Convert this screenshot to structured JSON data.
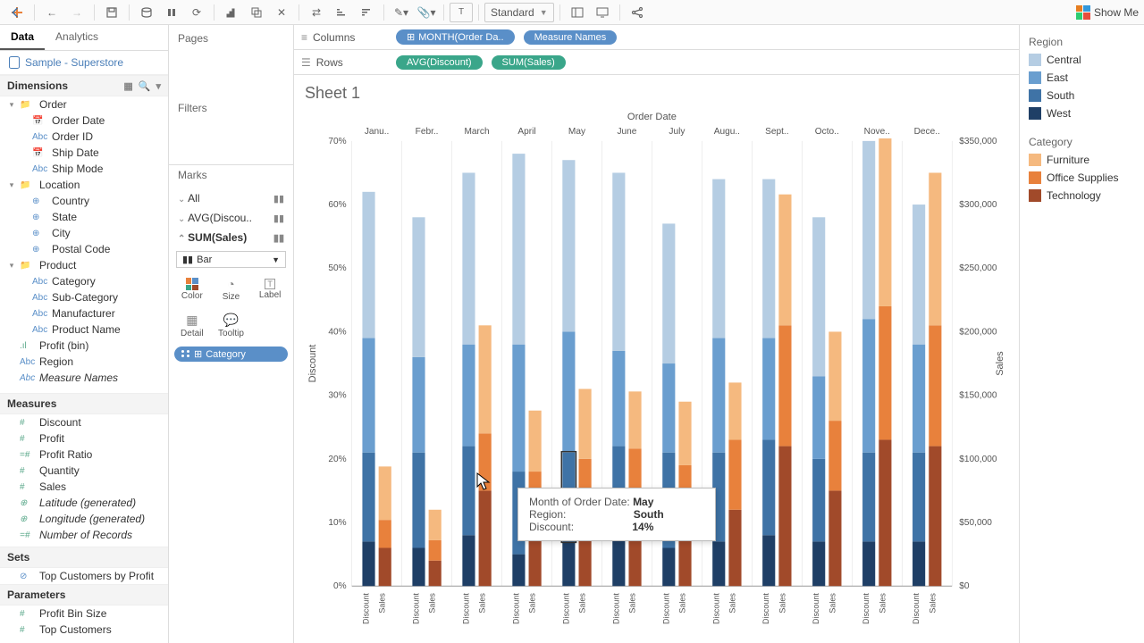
{
  "toolbar": {
    "fit": "Standard",
    "showme": "Show Me"
  },
  "side": {
    "tabs": {
      "data": "Data",
      "analytics": "Analytics"
    },
    "datasource": "Sample - Superstore",
    "dimensions_hdr": "Dimensions",
    "measures_hdr": "Measures",
    "sets_hdr": "Sets",
    "params_hdr": "Parameters",
    "dims": {
      "order": "Order",
      "order_date": "Order Date",
      "order_id": "Order ID",
      "ship_date": "Ship Date",
      "ship_mode": "Ship Mode",
      "location": "Location",
      "country": "Country",
      "state": "State",
      "city": "City",
      "postal": "Postal Code",
      "product": "Product",
      "category": "Category",
      "subcat": "Sub-Category",
      "manufacturer": "Manufacturer",
      "prodname": "Product Name",
      "profit_bin": "Profit (bin)",
      "region": "Region",
      "measure_names": "Measure Names"
    },
    "meas": {
      "discount": "Discount",
      "profit": "Profit",
      "profit_ratio": "Profit Ratio",
      "quantity": "Quantity",
      "sales": "Sales",
      "lat": "Latitude (generated)",
      "lon": "Longitude (generated)",
      "nrec": "Number of Records"
    },
    "sets": {
      "top_cust": "Top Customers by Profit"
    },
    "params": {
      "bin": "Profit Bin Size",
      "top": "Top Customers"
    }
  },
  "shelves": {
    "pages": "Pages",
    "filters": "Filters",
    "marks": "Marks",
    "all": "All",
    "avg_disc": "AVG(Discou..",
    "sum_sales": "SUM(Sales)",
    "mark_type": "Bar",
    "cells": {
      "color": "Color",
      "size": "Size",
      "label": "Label",
      "detail": "Detail",
      "tooltip": "Tooltip"
    },
    "ctx_pill": "Category"
  },
  "rowscols": {
    "columns": "Columns",
    "rows": "Rows",
    "month_pill": "MONTH(Order Da..",
    "measure_names": "Measure Names",
    "avg_disc": "AVG(Discount)",
    "sum_sales": "SUM(Sales)"
  },
  "sheet": {
    "title": "Sheet 1"
  },
  "tooltip": {
    "l1": "Month of Order Date:",
    "v1": "May",
    "l2": "Region:",
    "v2": "South",
    "l3": "Discount:",
    "v3": "14%"
  },
  "legend": {
    "region": "Region",
    "central": "Central",
    "east": "East",
    "south": "South",
    "west": "West",
    "category": "Category",
    "furniture": "Furniture",
    "office": "Office Supplies",
    "tech": "Technology"
  },
  "colors": {
    "central": "#b5cde3",
    "east": "#6a9ecf",
    "south": "#3f73a6",
    "west": "#1f3f66",
    "furniture": "#f5b97f",
    "office": "#e8813c",
    "tech": "#a14a2a"
  },
  "chart_data": {
    "type": "bar",
    "title": "Order Date",
    "y_left_label": "Discount",
    "y_right_label": "Sales",
    "categories": [
      "Janu..",
      "Febr..",
      "March",
      "April",
      "May",
      "June",
      "July",
      "Augu..",
      "Sept..",
      "Octo..",
      "Nove..",
      "Dece.."
    ],
    "bottom_labels": [
      "Discount",
      "Sales"
    ],
    "y_left": {
      "min": 0,
      "max": 0.7,
      "ticks": [
        0,
        0.1,
        0.2,
        0.3,
        0.4,
        0.5,
        0.6,
        0.7
      ],
      "tick_labels": [
        "0%",
        "10%",
        "20%",
        "30%",
        "40%",
        "50%",
        "60%",
        "70%"
      ]
    },
    "y_right": {
      "min": 0,
      "max": 350000,
      "ticks": [
        0,
        50000,
        100000,
        150000,
        200000,
        250000,
        300000,
        350000
      ],
      "tick_labels": [
        "$0",
        "$50,000",
        "$100,000",
        "$150,000",
        "$200,000",
        "$250,000",
        "$300,000",
        "$350,000"
      ]
    },
    "discount_stack_order": [
      "west",
      "south",
      "east",
      "central"
    ],
    "sales_stack_order": [
      "tech",
      "office",
      "furniture"
    ],
    "discount": [
      {
        "west": 0.07,
        "south": 0.14,
        "east": 0.18,
        "central": 0.23
      },
      {
        "west": 0.06,
        "south": 0.15,
        "east": 0.15,
        "central": 0.22
      },
      {
        "west": 0.08,
        "south": 0.14,
        "east": 0.16,
        "central": 0.27
      },
      {
        "west": 0.05,
        "south": 0.13,
        "east": 0.2,
        "central": 0.3
      },
      {
        "west": 0.07,
        "south": 0.14,
        "east": 0.19,
        "central": 0.27
      },
      {
        "west": 0.08,
        "south": 0.14,
        "east": 0.15,
        "central": 0.28
      },
      {
        "west": 0.06,
        "south": 0.15,
        "east": 0.14,
        "central": 0.22
      },
      {
        "west": 0.07,
        "south": 0.14,
        "east": 0.18,
        "central": 0.25
      },
      {
        "west": 0.08,
        "south": 0.15,
        "east": 0.16,
        "central": 0.25
      },
      {
        "west": 0.07,
        "south": 0.13,
        "east": 0.13,
        "central": 0.25
      },
      {
        "west": 0.07,
        "south": 0.14,
        "east": 0.21,
        "central": 0.28
      },
      {
        "west": 0.07,
        "south": 0.14,
        "east": 0.17,
        "central": 0.22
      }
    ],
    "sales": [
      {
        "tech": 30000,
        "office": 22000,
        "furniture": 42000
      },
      {
        "tech": 20000,
        "office": 16000,
        "furniture": 24000
      },
      {
        "tech": 75000,
        "office": 45000,
        "furniture": 85000
      },
      {
        "tech": 50000,
        "office": 40000,
        "furniture": 48000
      },
      {
        "tech": 55000,
        "office": 45000,
        "furniture": 55000
      },
      {
        "tech": 60000,
        "office": 48000,
        "furniture": 45000
      },
      {
        "tech": 55000,
        "office": 40000,
        "furniture": 50000
      },
      {
        "tech": 60000,
        "office": 55000,
        "furniture": 45000
      },
      {
        "tech": 110000,
        "office": 95000,
        "furniture": 103000
      },
      {
        "tech": 75000,
        "office": 55000,
        "furniture": 70000
      },
      {
        "tech": 115000,
        "office": 105000,
        "furniture": 132000
      },
      {
        "tech": 110000,
        "office": 95000,
        "furniture": 120000
      }
    ]
  }
}
